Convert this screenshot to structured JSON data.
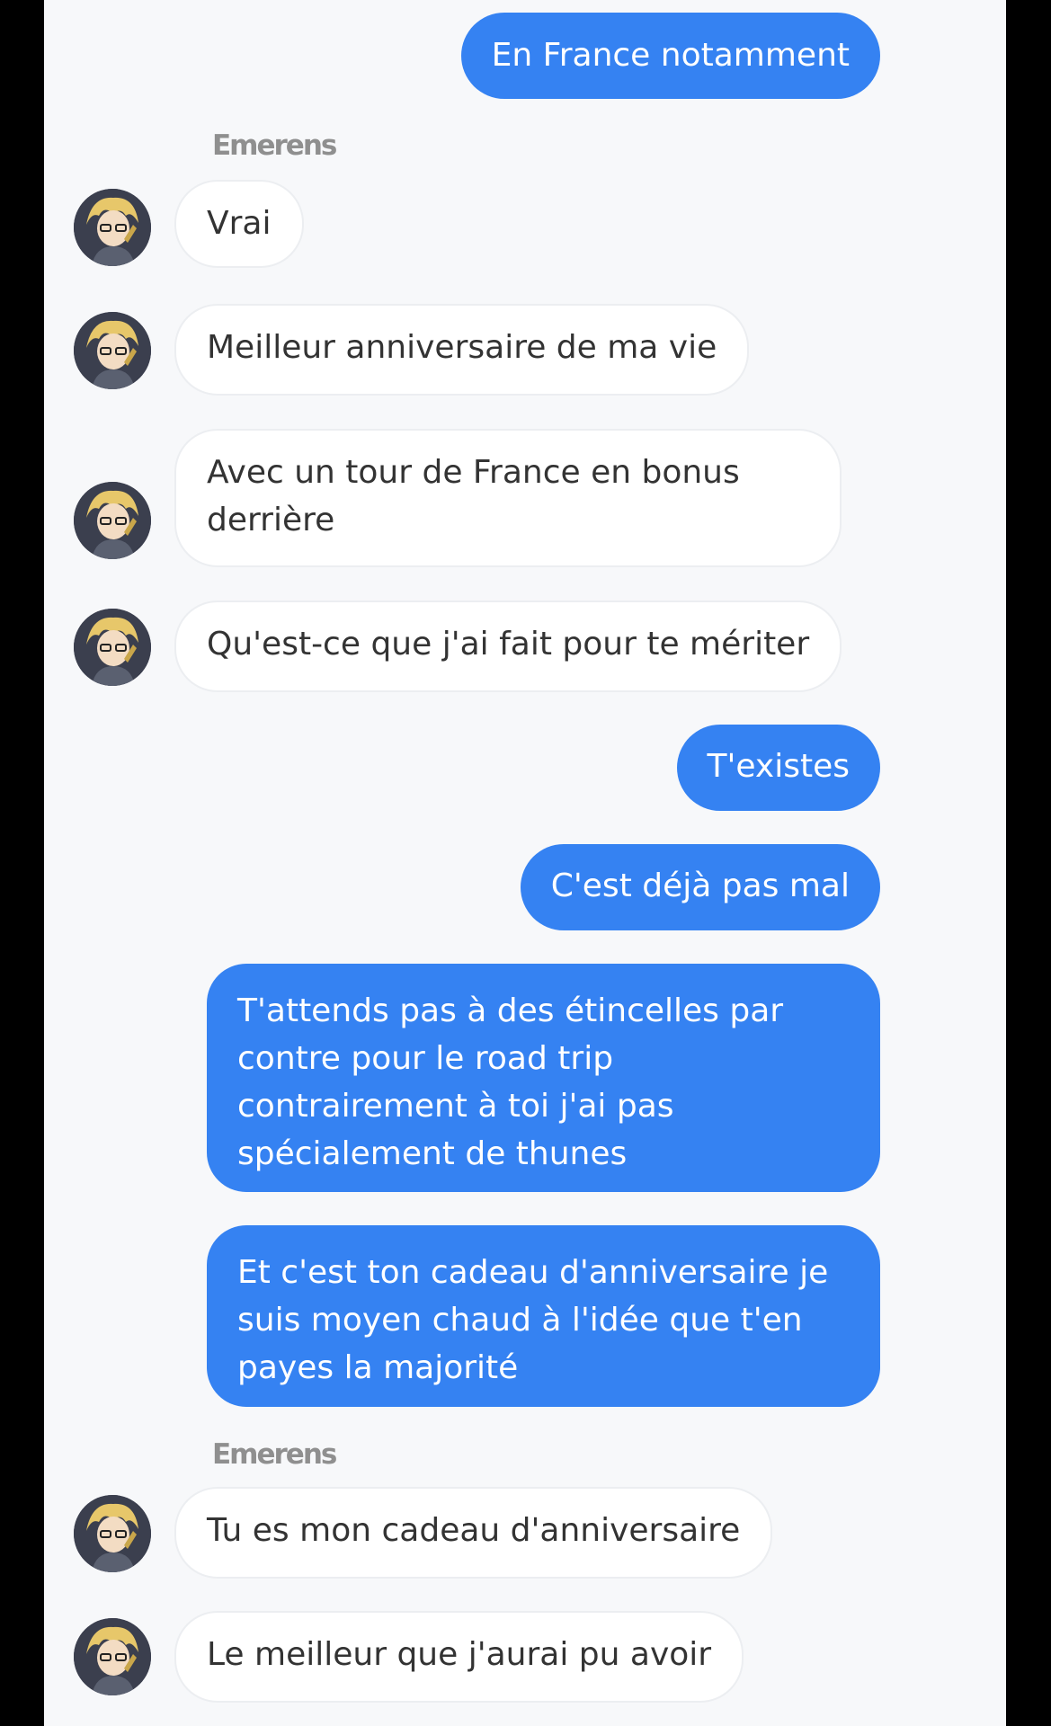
{
  "conversation": {
    "sender_name": "Emerens",
    "messages": [
      {
        "direction": "outgoing",
        "text": "En France notamment"
      },
      {
        "direction": "incoming",
        "text": "Vrai"
      },
      {
        "direction": "incoming",
        "text": "Meilleur anniversaire de ma vie"
      },
      {
        "direction": "incoming",
        "text": "Avec un tour de France en bonus derrière"
      },
      {
        "direction": "incoming",
        "text": "Qu'est-ce que j'ai fait pour te mériter"
      },
      {
        "direction": "outgoing",
        "text": "T'existes"
      },
      {
        "direction": "outgoing",
        "text": "C'est déjà pas mal"
      },
      {
        "direction": "outgoing",
        "text": "T'attends pas à des étincelles par contre pour le road trip contrairement à toi j'ai pas spécialement de thunes"
      },
      {
        "direction": "outgoing",
        "text": "Et c'est ton cadeau d'anniversaire je suis moyen chaud à l'idée que t'en payes la majorité"
      },
      {
        "direction": "incoming",
        "text": "Tu es mon cadeau d'anniversaire"
      },
      {
        "direction": "incoming",
        "text": "Le meilleur que j'aurai pu avoir"
      }
    ]
  },
  "colors": {
    "outgoing_bubble": "#3582f2",
    "incoming_bubble": "#ffffff",
    "background": "#f7f8fa"
  },
  "icons": {
    "avatar": "anime-avatar-blond-character"
  }
}
